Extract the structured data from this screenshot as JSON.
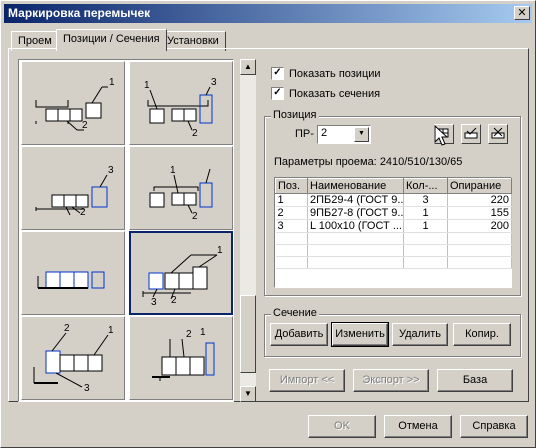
{
  "window": {
    "title": "Маркировка перемычек",
    "close_glyph": "✕"
  },
  "tabs": [
    {
      "label": "Проем"
    },
    {
      "label": "Позиции / Сечения",
      "active": true
    },
    {
      "label": "Установки"
    }
  ],
  "thumbnails": [
    {
      "labels": [
        "1",
        "2"
      ]
    },
    {
      "labels": [
        "1",
        "3",
        "2"
      ]
    },
    {
      "labels": [
        "3",
        "2"
      ]
    },
    {
      "labels": [
        "1",
        "2"
      ]
    },
    {
      "labels": []
    },
    {
      "labels": [
        "1",
        "3",
        "2"
      ],
      "selected": true
    },
    {
      "labels": [
        "2",
        "1",
        "3"
      ]
    },
    {
      "labels": [
        "1",
        "2"
      ]
    }
  ],
  "options": {
    "show_positions": {
      "label": "Показать позиции",
      "checked": true
    },
    "show_sections": {
      "label": "Показать сечения",
      "checked": true
    }
  },
  "position": {
    "group_title": "Позиция",
    "pr_label": "ПР-",
    "pr_value": "2",
    "params_label": "Параметры проема:",
    "params_value": "2410/510/130/65",
    "table": {
      "headers": [
        "Поз.",
        "Наименование",
        "Кол-...",
        "Опирание"
      ],
      "rows": [
        [
          "1",
          "2ПБ29-4 (ГОСТ 9...",
          "3",
          "220"
        ],
        [
          "2",
          "9ПБ27-8 (ГОСТ 9...",
          "1",
          "155"
        ],
        [
          "3",
          "L 100x10 (ГОСТ ...",
          "1",
          "200"
        ]
      ]
    },
    "icon_buttons": [
      "profile-edit-icon",
      "checkmark-stack-icon",
      "delete-stack-icon"
    ]
  },
  "section": {
    "group_title": "Сечение",
    "buttons": {
      "add": "Добавить",
      "change": "Изменить",
      "delete": "Удалить",
      "copy": "Копир."
    }
  },
  "io": {
    "import": "Импорт <<",
    "export": "Экспорт >>",
    "base": "База"
  },
  "footer": {
    "ok": "OK",
    "cancel": "Отмена",
    "help": "Справка"
  },
  "colors": {
    "title_start": "#0a246a",
    "title_end": "#a6caf0",
    "highlight_block": "#0033cc"
  }
}
